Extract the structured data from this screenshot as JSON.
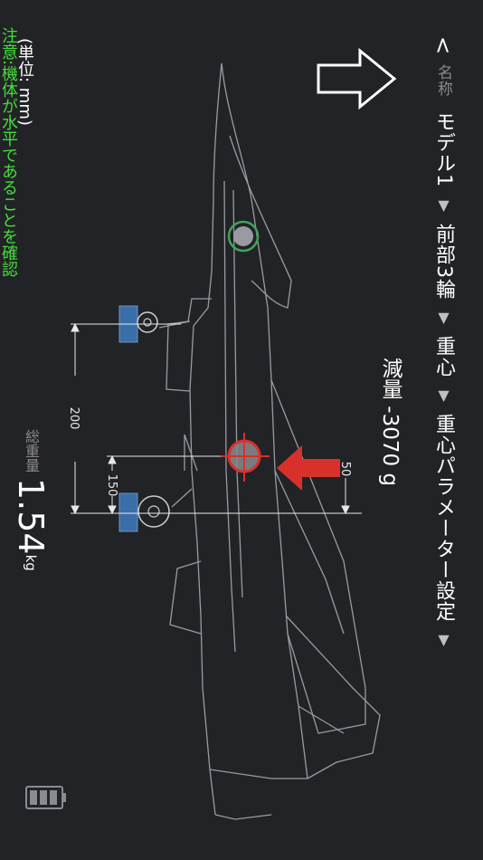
{
  "nav": {
    "back_glyph": "<",
    "name_label": "名称",
    "model": "モデル1",
    "front": "前部3輪",
    "cg": "重心",
    "settings": "重心パラメーター設定",
    "separator": "▼"
  },
  "reduction": "減量 -3070 g",
  "unit_text": "(単位: mm)",
  "note": {
    "prefix": "注意:",
    "text": "機体が水平であることを確認"
  },
  "total_weight": {
    "label": "総重量",
    "value": "1.54",
    "unit": "kg"
  },
  "dimensions": {
    "d200": "200",
    "d150": "150",
    "d50": "50"
  },
  "colors": {
    "background": "#222326",
    "note_green": "#44dd3c",
    "arrow_red": "#d8312c",
    "wheel_blue": "#3a6ea8",
    "cg_green": "#3fa45a"
  },
  "icons": {
    "battery": "battery-icon",
    "arrow": "direction-arrow-icon"
  }
}
